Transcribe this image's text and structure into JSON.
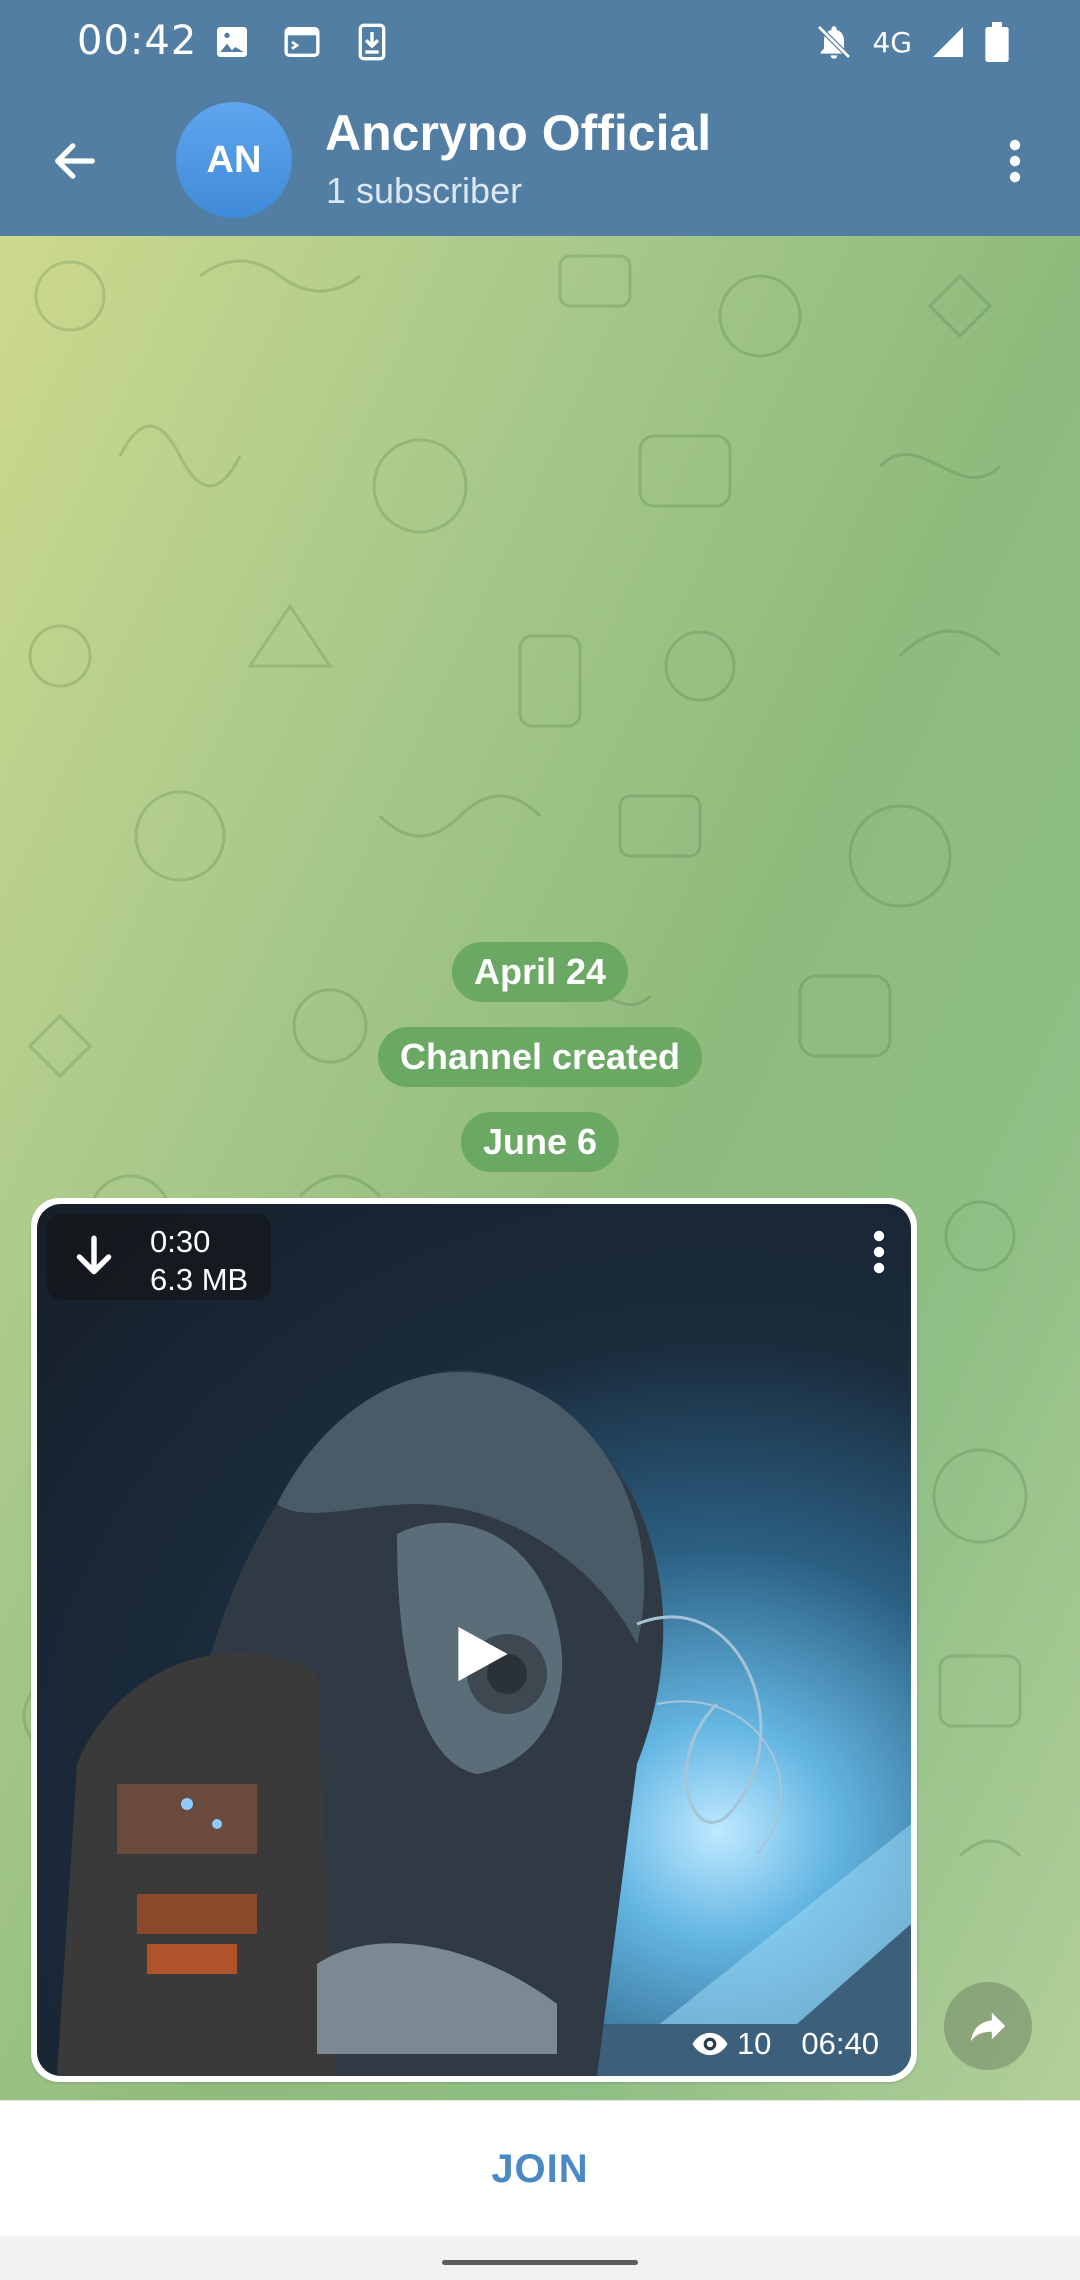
{
  "status_bar": {
    "time": "00:42",
    "network": "4G",
    "left_icons": [
      "image-icon",
      "screenshot-icon",
      "download-icon"
    ],
    "right_icons": [
      "bell-off-icon",
      "signal-icon",
      "battery-icon"
    ]
  },
  "header": {
    "avatar_initials": "AN",
    "title": "Ancryno Official",
    "subtitle": "1 subscriber",
    "back_icon": "arrow-left-icon",
    "menu_icon": "more-vertical-icon"
  },
  "chat": {
    "service_messages": [
      "April 24",
      "Channel created",
      "June 6"
    ],
    "post": {
      "duration": "0:30",
      "size": "6.3 MB",
      "views": "10",
      "time": "06:40"
    }
  },
  "footer": {
    "join_label": "JOIN"
  },
  "colors": {
    "header_bg": "#537ea3",
    "avatar_bg": "#4a96e4",
    "service_pill_bg": "#6aa863",
    "join_text": "#4a89c5"
  }
}
